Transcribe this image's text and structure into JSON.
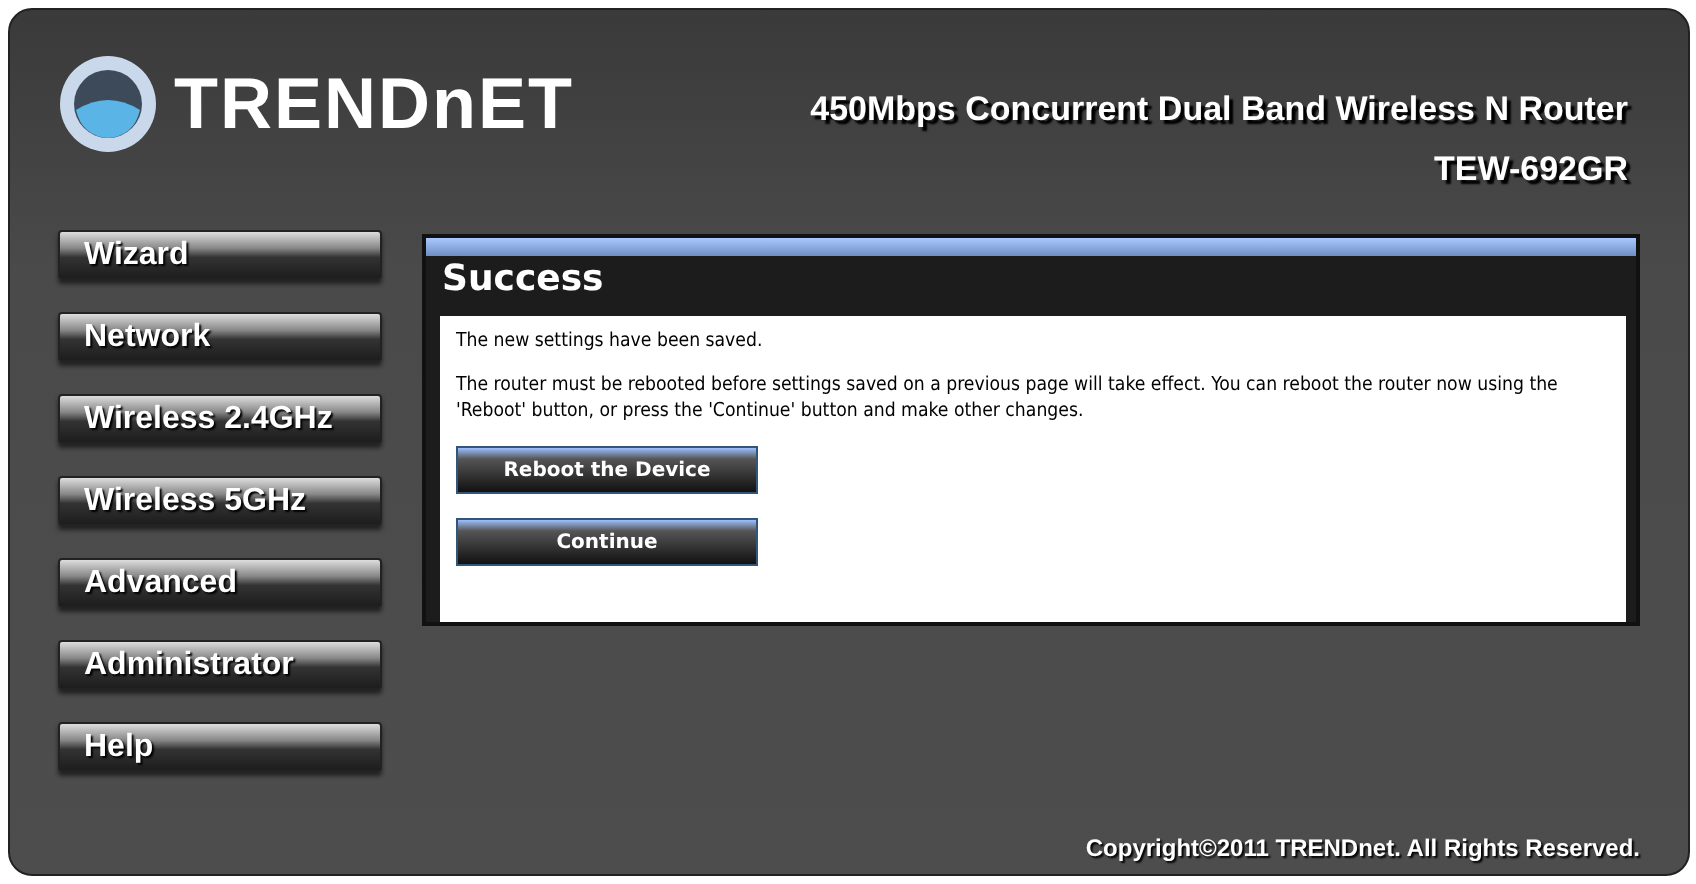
{
  "header": {
    "logo_text": "TRENDnET",
    "product_title": "450Mbps Concurrent Dual Band Wireless N Router",
    "model": "TEW-692GR"
  },
  "sidebar": {
    "items": [
      {
        "label": "Wizard"
      },
      {
        "label": "Network"
      },
      {
        "label": "Wireless 2.4GHz"
      },
      {
        "label": "Wireless 5GHz"
      },
      {
        "label": "Advanced"
      },
      {
        "label": "Administrator"
      },
      {
        "label": "Help"
      }
    ]
  },
  "panel": {
    "title": "Success",
    "messages": [
      "The new settings have been saved.",
      "The router must be rebooted before settings saved on a previous page will take effect. You can reboot the router now using the 'Reboot' button, or press the 'Continue' button and make other changes."
    ],
    "buttons": [
      "Reboot the Device",
      "Continue"
    ]
  },
  "footer": {
    "copyright": "Copyright©2011 TRENDnet. All Rights Reserved."
  }
}
